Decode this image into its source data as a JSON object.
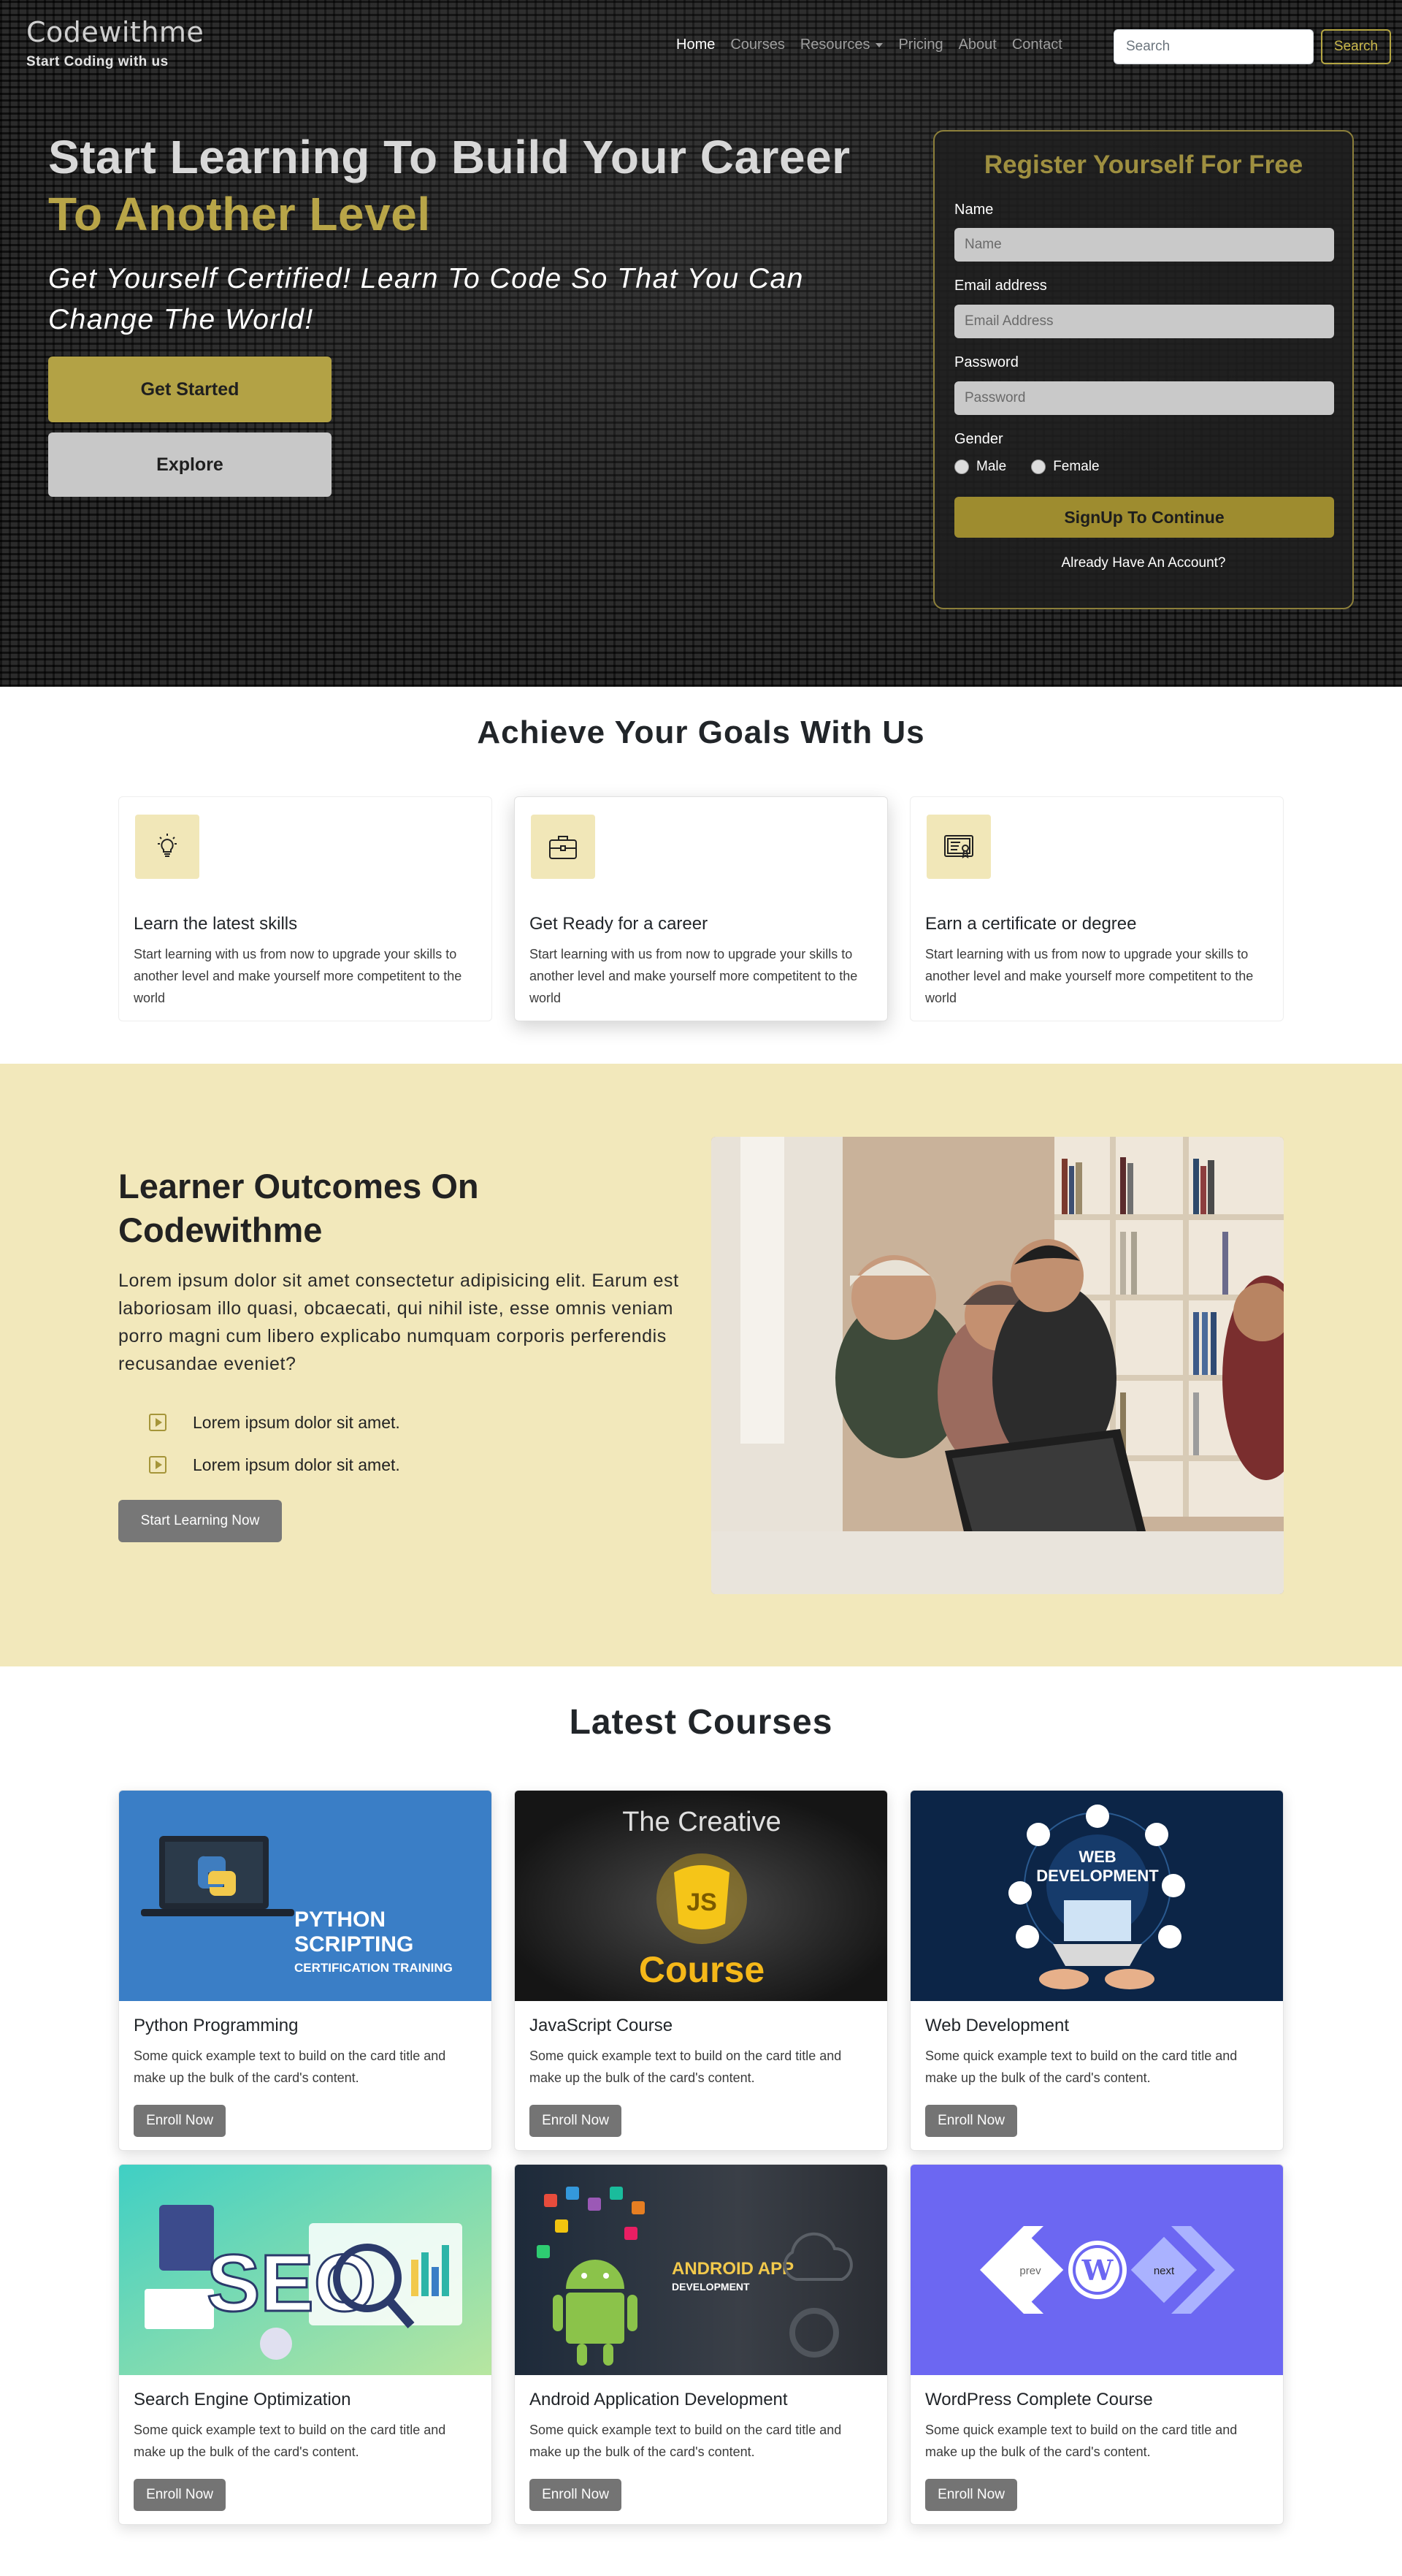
{
  "navbar": {
    "brand_name": "Codewithme",
    "brand_tagline": "Start Coding with us",
    "links": [
      "Home",
      "Courses",
      "Resources",
      "Pricing",
      "About",
      "Contact"
    ],
    "active_link": "Home",
    "search_placeholder": "Search",
    "search_button": "Search"
  },
  "hero": {
    "title_line1": "Start Learning To Build Your Career",
    "title_line2": "To Another Level",
    "subtitle": "Get Yourself Certified! Learn To Code So That You Can Change The World!",
    "get_started": "Get Started",
    "explore": "Explore"
  },
  "register": {
    "title": "Register Yourself For Free",
    "name_label": "Name",
    "name_placeholder": "Name",
    "email_label": "Email address",
    "email_placeholder": "Email Address",
    "password_label": "Password",
    "password_placeholder": "Password",
    "gender_label": "Gender",
    "gender_options": [
      "Male",
      "Female"
    ],
    "signup_button": "SignUp To Continue",
    "login_link": "Already Have An Account?"
  },
  "goals": {
    "title": "Achieve Your Goals With Us",
    "cards": [
      {
        "title": "Learn the latest skills",
        "text": "Start learning with us from now to upgrade your skills to another level and make yourself more competitent to the world",
        "icon": "lightbulb-icon"
      },
      {
        "title": "Get Ready for a career",
        "text": "Start learning with us from now to upgrade your skills to another level and make yourself more competitent to the world",
        "icon": "briefcase-icon"
      },
      {
        "title": "Earn a certificate or degree",
        "text": "Start learning with us from now to upgrade your skills to another level and make yourself more competitent to the world",
        "icon": "certificate-icon"
      }
    ]
  },
  "outcomes": {
    "title": "Learner Outcomes On Codewithme",
    "text": "Lorem ipsum dolor sit amet consectetur adipisicing elit. Earum est laboriosam illo quasi, obcaecati, qui nihil iste, esse omnis veniam porro magni cum libero explicabo numquam corporis perferendis recusandae eveniet?",
    "items": [
      "Lorem ipsum dolor sit amet.",
      "Lorem ipsum dolor sit amet."
    ],
    "button": "Start Learning Now"
  },
  "courses": {
    "title": "Latest Courses",
    "items": [
      {
        "title": "Python Programming",
        "text": "Some quick example text to build on the card title and make up the bulk of the card's content.",
        "button": "Enroll Now",
        "image_text": [
          "PYTHON",
          "SCRIPTING",
          "CERTIFICATION TRAINING"
        ]
      },
      {
        "title": "JavaScript Course",
        "text": "Some quick example text to build on the card title and make up the bulk of the card's content.",
        "button": "Enroll Now",
        "image_text": [
          "The Creative",
          "Course",
          "JS"
        ]
      },
      {
        "title": "Web Development",
        "text": "Some quick example text to build on the card title and make up the bulk of the card's content.",
        "button": "Enroll Now",
        "image_text": [
          "WEB",
          "DEVELOPMENT"
        ]
      },
      {
        "title": "Search Engine Optimization",
        "text": "Some quick example text to build on the card title and make up the bulk of the card's content.",
        "button": "Enroll Now",
        "image_text": [
          "SEO"
        ]
      },
      {
        "title": "Android Application Development",
        "text": "Some quick example text to build on the card title and make up the bulk of the card's content.",
        "button": "Enroll Now",
        "image_text": [
          "ANDROID APP",
          "DEVELOPMENT"
        ]
      },
      {
        "title": "WordPress Complete Course",
        "text": "Some quick example text to build on the card title and make up the bulk of the card's content.",
        "button": "Enroll Now",
        "image_text": [
          "prev",
          "next"
        ]
      }
    ]
  },
  "colors": {
    "accent_gold": "#b3a245",
    "outcomes_bg": "#f2e8bb",
    "icon_bg": "#f1e7b8"
  }
}
